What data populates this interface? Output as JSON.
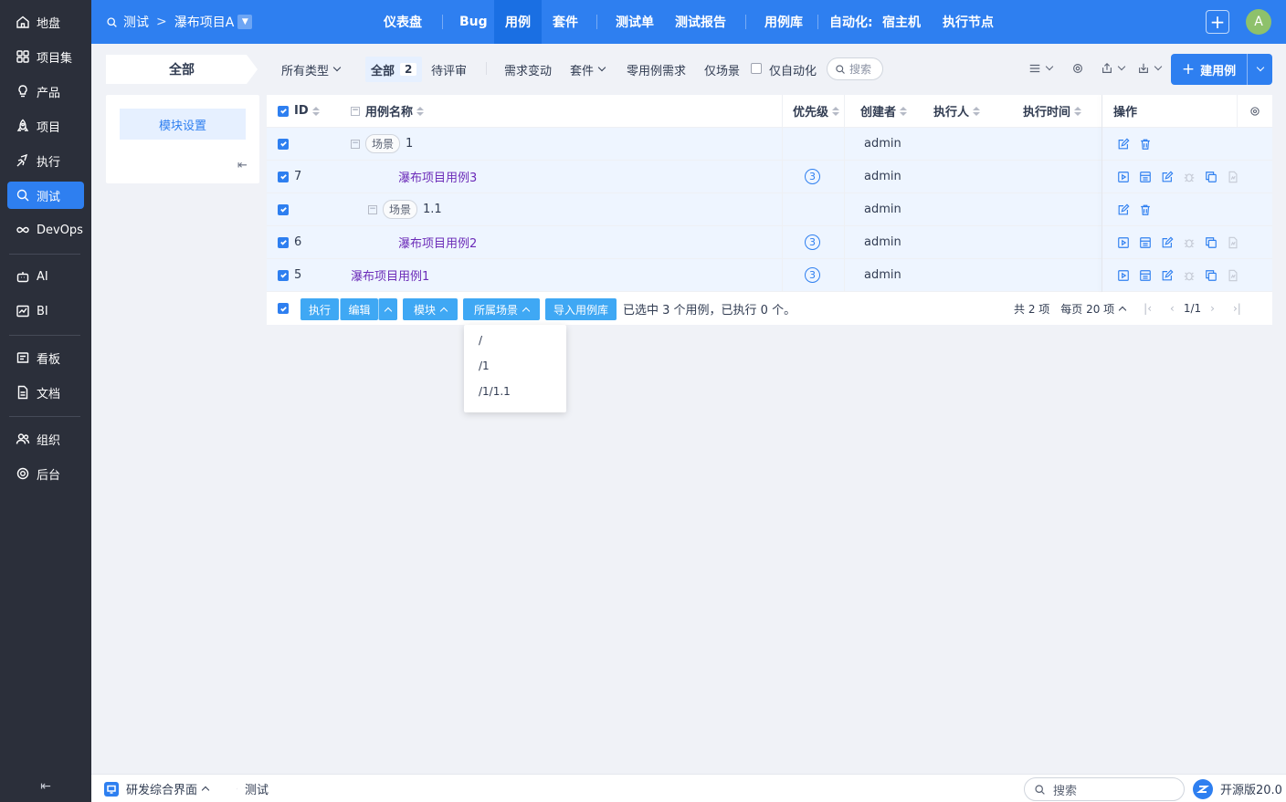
{
  "sidebar": {
    "items": [
      {
        "label": "地盘",
        "icon": "home-icon"
      },
      {
        "label": "项目集",
        "icon": "grid-icon"
      },
      {
        "label": "产品",
        "icon": "bulb-icon"
      },
      {
        "label": "项目",
        "icon": "rocket-icon"
      },
      {
        "label": "执行",
        "icon": "send-icon"
      },
      {
        "label": "测试",
        "icon": "search-icon",
        "active": true
      },
      {
        "label": "DevOps",
        "icon": "infinity-icon"
      },
      {
        "label": "AI",
        "icon": "robot-icon"
      },
      {
        "label": "BI",
        "icon": "chart-icon"
      },
      {
        "label": "看板",
        "icon": "kanban-icon"
      },
      {
        "label": "文档",
        "icon": "doc-icon"
      },
      {
        "label": "组织",
        "icon": "people-icon"
      },
      {
        "label": "后台",
        "icon": "gear-icon"
      }
    ],
    "collapse_glyph": "⇤"
  },
  "header": {
    "crumb_root": "测试",
    "crumb_sep": ">",
    "crumb_project": "瀑布项目A",
    "nav": [
      "仪表盘",
      "Bug",
      "用例",
      "套件",
      "测试单",
      "测试报告",
      "用例库",
      "自动化:",
      "宿主机",
      "执行节点"
    ],
    "active_nav": "用例",
    "plus": "+",
    "avatar": "A"
  },
  "toolbar": {
    "module_tab": "全部",
    "all_types": "所有类型",
    "all": "全部",
    "all_count": "2",
    "pending_review": "待评审",
    "req_changed": "需求变动",
    "suite": "套件",
    "zero_case_req": "零用例需求",
    "only_scene": "仅场景",
    "only_auto": "仅自动化",
    "search_placeholder": "搜索",
    "create_label": "建用例"
  },
  "module_panel": {
    "settings_label": "模块设置",
    "collapse_glyph": "⇤"
  },
  "table": {
    "columns": {
      "id": "ID",
      "name": "用例名称",
      "priority": "优先级",
      "creator": "创建者",
      "executor": "执行人",
      "exec_time": "执行时间",
      "actions": "操作"
    },
    "rows": [
      {
        "type": "scene",
        "id": "",
        "scene_tag": "场景",
        "name": "1",
        "priority": "",
        "creator": "admin",
        "level": 0
      },
      {
        "type": "case",
        "id": "7",
        "name": "瀑布项目用例3",
        "priority": "3",
        "creator": "admin",
        "level": 1
      },
      {
        "type": "scene",
        "id": "",
        "scene_tag": "场景",
        "name": "1.1",
        "priority": "",
        "creator": "admin",
        "level": 1
      },
      {
        "type": "case",
        "id": "6",
        "name": "瀑布项目用例2",
        "priority": "3",
        "creator": "admin",
        "level": 2
      },
      {
        "type": "case",
        "id": "5",
        "name": "瀑布项目用例1",
        "priority": "3",
        "creator": "admin",
        "level": 0
      }
    ]
  },
  "footer": {
    "run": "执行",
    "edit": "编辑",
    "module": "模块",
    "scene": "所属场景",
    "import_lib": "导入用例库",
    "selection_info": "已选中 3 个用例，已执行 0 个。",
    "total": "共 2 项",
    "per_page": "每页 20 项",
    "page": "1/1"
  },
  "dropdown": {
    "items": [
      "/",
      "/1",
      "/1/1.1"
    ]
  },
  "bottombar": {
    "workspace": "研发综合界面",
    "tab": "测试",
    "search_placeholder": "搜索",
    "version": "开源版20.0"
  },
  "colors": {
    "primary": "#2e7ff0",
    "sidebar_bg": "#2b2f3a",
    "link_purple": "#6b2bb8",
    "footer_btn": "#3fa8f4"
  }
}
